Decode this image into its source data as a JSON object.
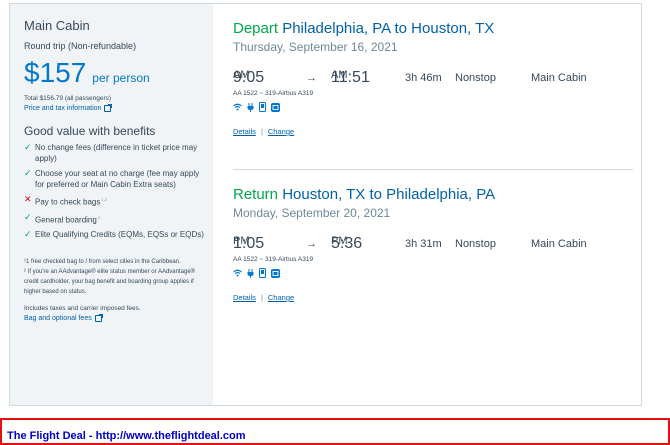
{
  "sidebar": {
    "title": "Main Cabin",
    "trip_type": "Round trip (Non-refundable)",
    "price": "$157",
    "per_person": "per person",
    "total": "Total $156.79 (all passengers)",
    "price_tax_link": "Price and tax information",
    "benefits_title": "Good value with benefits",
    "benefits": [
      {
        "text": "No change fees (difference in ticket price may apply)",
        "included": true,
        "sup": ""
      },
      {
        "text": "Choose your seat at no charge (fee may apply for preferred or Main Cabin Extra seats)",
        "included": true,
        "sup": ""
      },
      {
        "text": "Pay to check bags",
        "included": false,
        "sup": "1,2"
      },
      {
        "text": "General boarding",
        "included": true,
        "sup": "2"
      },
      {
        "text": "Elite Qualifying Credits (EQMs, EQSs or EQDs)",
        "included": true,
        "sup": ""
      }
    ],
    "footnote1": "¹1 free checked bag to / from select cities in the Caribbean.",
    "footnote2": "² If you're an AAdvantage® elite status member or AAdvantage® credit cardholder, your bag benefit and boarding group applies if higher based on status.",
    "taxes_note": "Includes taxes and carrier imposed fees.",
    "bag_fees_link": "Bag and optional fees"
  },
  "segments": [
    {
      "direction": "Depart",
      "route": "Philadelphia, PA to Houston, TX",
      "date": "Thursday, September 16, 2021",
      "depart_time": "9:05",
      "depart_ampm": "AM",
      "arrow": "→",
      "arrive_time": "11:51",
      "arrive_ampm": "AM",
      "duration": "3h 46m",
      "stops": "Nonstop",
      "cabin": "Main Cabin",
      "flight": "AA 1522",
      "aircraft": "319-Airbus A319",
      "details_link": "Details",
      "change_link": "Change"
    },
    {
      "direction": "Return",
      "route": "Houston, TX to Philadelphia, PA",
      "date": "Monday, September 20, 2021",
      "depart_time": "1:05",
      "depart_ampm": "PM",
      "arrow": "→",
      "arrive_time": "5:36",
      "arrive_ampm": "PM",
      "duration": "3h 31m",
      "stops": "Nonstop",
      "cabin": "Main Cabin",
      "flight": "AA 1522",
      "aircraft": "319-Airbus A319",
      "details_link": "Details",
      "change_link": "Change"
    }
  ],
  "separator": "|",
  "flight_sep": "=",
  "amenity_icons": [
    "wifi-icon",
    "power-icon",
    "mobile-entertainment-icon",
    "streaming-icon"
  ],
  "banner": {
    "text": "The Flight Deal - http://www.theflightdeal.com"
  },
  "colors": {
    "accent_blue": "#0078d2",
    "link_blue": "#0061ab",
    "green": "#00a84f",
    "red": "#d0021b",
    "banner_border": "#e31010"
  }
}
